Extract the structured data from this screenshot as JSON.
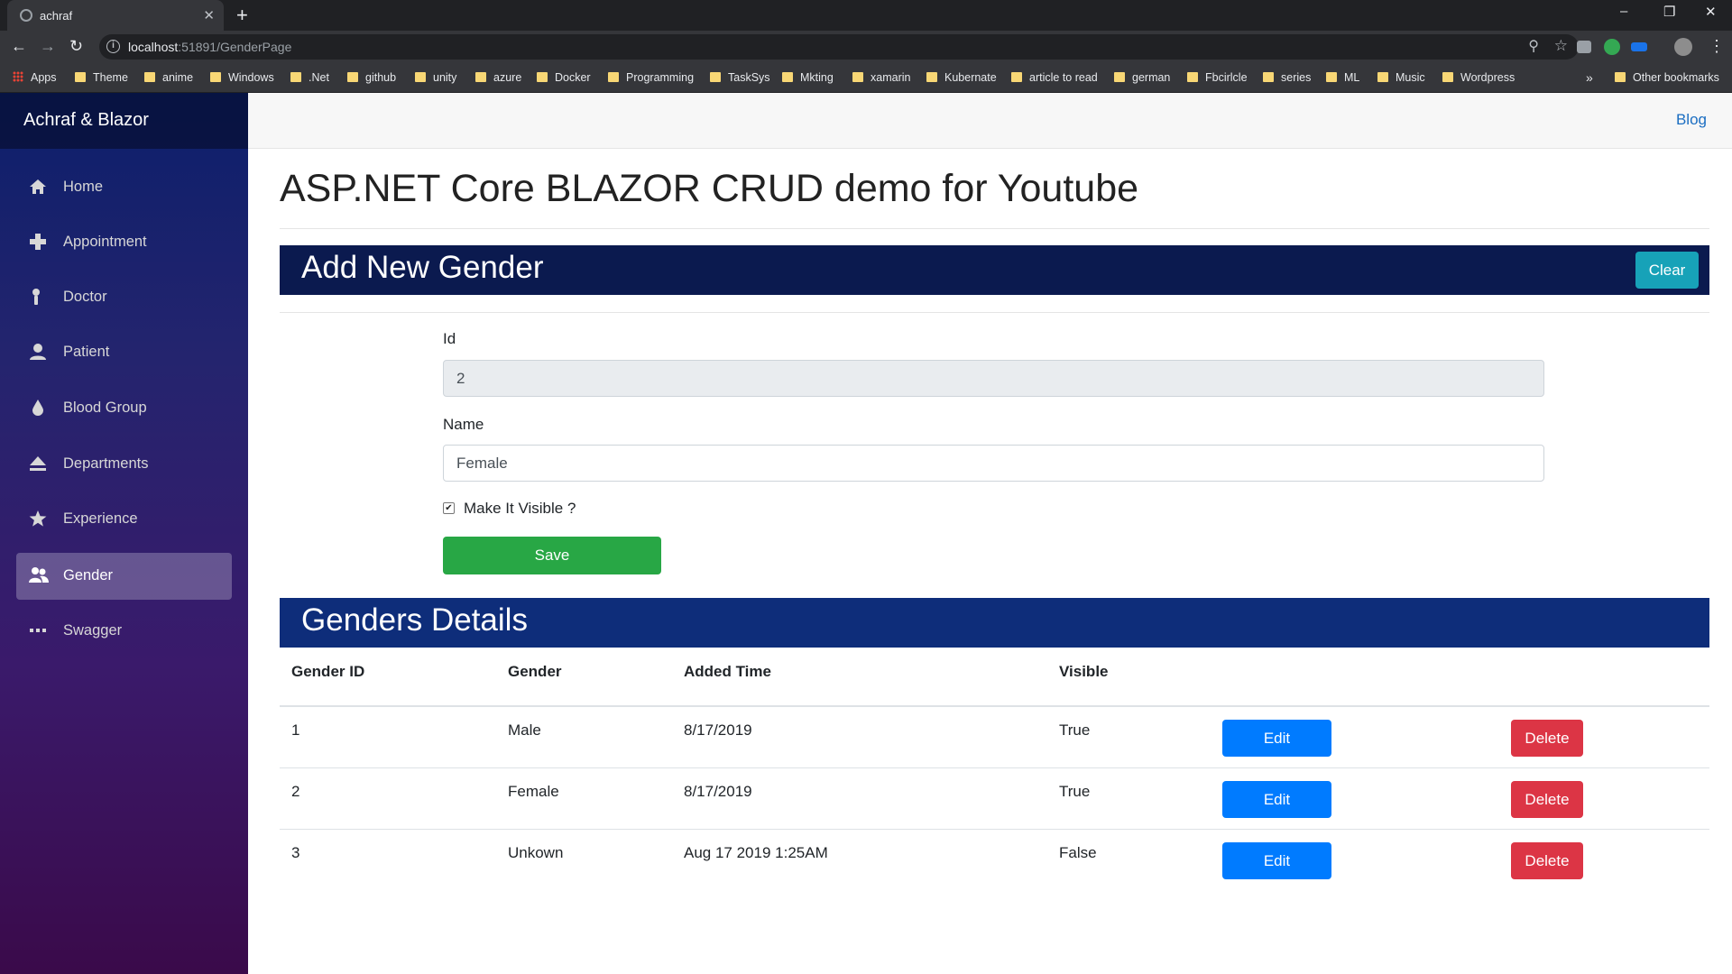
{
  "browser": {
    "tab_title": "achraf",
    "url_host": "localhost",
    "url_path": ":51891/GenderPage",
    "bookmarks": [
      "Apps",
      "Theme",
      "anime",
      "Windows",
      ".Net",
      "github",
      "unity",
      "azure",
      "Docker",
      "Programming",
      "TaskSys",
      "Mkting",
      "xamarin",
      "Kubernate",
      "article to read",
      "german",
      "Fbcirlcle",
      "series",
      "ML",
      "Music",
      "Wordpress"
    ],
    "overflow": "»",
    "other_bookmarks": "Other bookmarks"
  },
  "app": {
    "brand": "Achraf & Blazor",
    "top_link": "Blog",
    "nav": [
      {
        "label": "Home",
        "icon": "home-icon"
      },
      {
        "label": "Appointment",
        "icon": "plus-icon"
      },
      {
        "label": "Doctor",
        "icon": "person-pin-icon"
      },
      {
        "label": "Patient",
        "icon": "person-icon"
      },
      {
        "label": "Blood Group",
        "icon": "droplet-icon"
      },
      {
        "label": "Departments",
        "icon": "eject-icon"
      },
      {
        "label": "Experience",
        "icon": "star-icon"
      },
      {
        "label": "Gender",
        "icon": "people-icon",
        "active": true
      },
      {
        "label": "Swagger",
        "icon": "ellipsis-icon"
      }
    ]
  },
  "page": {
    "title": "ASP.NET Core BLAZOR CRUD demo for Youtube",
    "form_header": "Add New Gender",
    "clear_label": "Clear",
    "id_label": "Id",
    "id_value": "2",
    "name_label": "Name",
    "name_value": "Female",
    "visible_label": "Make It Visible ?",
    "visible_checked": true,
    "save_label": "Save",
    "table_header": "Genders Details",
    "columns": [
      "Gender ID",
      "Gender",
      "Added Time",
      "Visible"
    ],
    "rows": [
      {
        "id": "1",
        "gender": "Male",
        "added": "8/17/2019",
        "visible": "True"
      },
      {
        "id": "2",
        "gender": "Female",
        "added": "8/17/2019",
        "visible": "True"
      },
      {
        "id": "3",
        "gender": "Unkown",
        "added": "Aug 17 2019 1:25AM",
        "visible": "False"
      }
    ],
    "edit_label": "Edit",
    "delete_label": "Delete"
  },
  "colors": {
    "save": "#28a745",
    "edit": "#007bff",
    "delete": "#dc3545",
    "clear": "#17a2b8",
    "link": "#1b6ec2"
  }
}
